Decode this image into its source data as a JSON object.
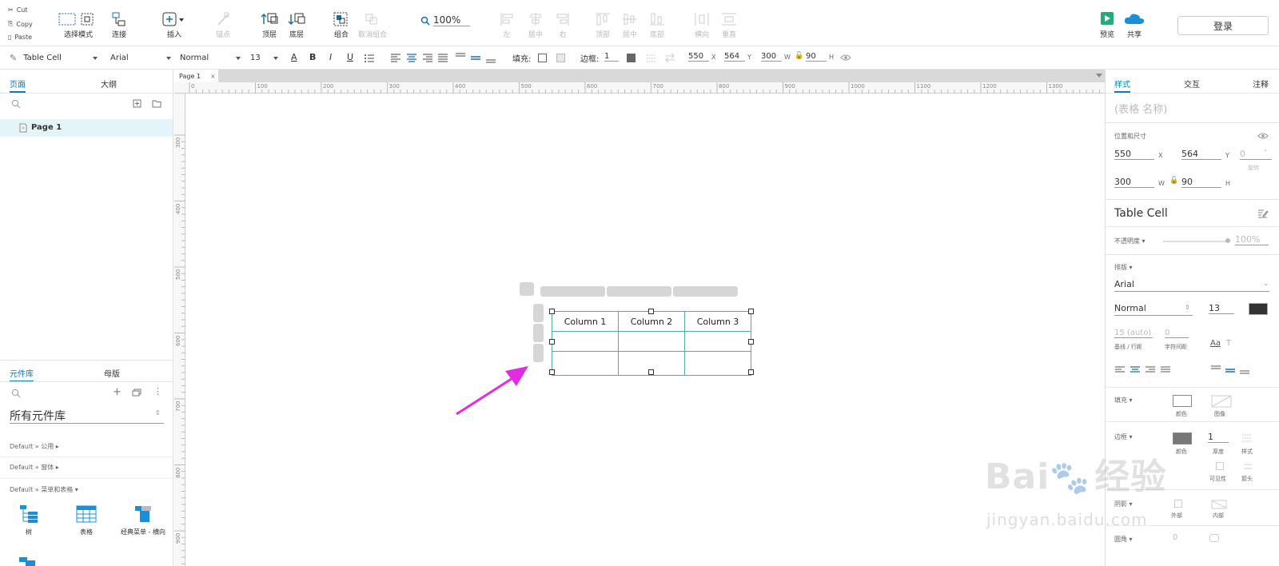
{
  "clipboard": {
    "cut": "Cut",
    "copy": "Copy",
    "paste": "Paste"
  },
  "toolbar": {
    "select_mode": "选择模式",
    "connect": "连接",
    "insert": "插入",
    "anchor": "锚点",
    "top_layer": "顶层",
    "bottom_layer": "底层",
    "group": "组合",
    "ungroup": "取消组合",
    "zoom": "100%",
    "align_left": "左",
    "align_center": "居中",
    "align_right": "右",
    "align_top": "顶部",
    "align_middle": "居中",
    "align_bottom": "底部",
    "dist_h": "横向",
    "dist_v": "垂直",
    "preview": "预览",
    "share": "共享",
    "login": "登录"
  },
  "format": {
    "widget_type": "Table Cell",
    "font": "Arial",
    "weight": "Normal",
    "size": "13",
    "fill_label": "填充:",
    "border_label": "边框:",
    "border_value": "1",
    "x": "550",
    "x_label": "X",
    "y": "564",
    "y_label": "Y",
    "w": "300",
    "w_label": "W",
    "h": "90",
    "h_label": "H"
  },
  "left": {
    "tab_pages": "页面",
    "tab_outline": "大纲",
    "pages": [
      "Page 1"
    ],
    "tab_library": "元件库",
    "tab_masters": "母版",
    "library_select": "所有元件库",
    "groups": [
      "Default » 公用 ▸",
      "Default » 窗体 ▸",
      "Default » 菜单和表格 ▾"
    ],
    "widgets": [
      "树",
      "表格",
      "经典菜单 - 横向"
    ]
  },
  "canvas": {
    "page_tab": "Page 1",
    "hruler": [
      "0",
      "100",
      "200",
      "300",
      "400",
      "500",
      "600",
      "700",
      "800",
      "900",
      "1000",
      "1100",
      "1200",
      "1300"
    ],
    "vruler": [
      "300",
      "400",
      "500",
      "600",
      "700",
      "800",
      "900"
    ],
    "table_headers": [
      "Column 1",
      "Column 2",
      "Column 3"
    ]
  },
  "right": {
    "tab_style": "样式",
    "tab_interact": "交互",
    "tab_notes": "注释",
    "name_placeholder": "(表格 名称)",
    "pos_size": "位置和尺寸",
    "x": "550",
    "x_label": "X",
    "y": "564",
    "y_label": "Y",
    "rot": "0",
    "rot_unit": "°",
    "rot_label": "旋转",
    "w": "300",
    "w_label": "W",
    "h": "90",
    "h_label": "H",
    "widget_type": "Table Cell",
    "opacity_label": "不透明度 ▾",
    "opacity": "100%",
    "typography_label": "排版 ▾",
    "font": "Arial",
    "weight": "Normal",
    "size": "13",
    "line_height": "15 (auto)",
    "char_spacing": "0",
    "line_height_label": "基线 / 行距",
    "char_spacing_label": "字符间距",
    "fill_label": "填充 ▾",
    "fill_color": "颜色",
    "fill_image": "图像",
    "border_label": "边框 ▾",
    "border_color": "颜色",
    "border_thickness_val": "1",
    "border_thickness": "厚度",
    "border_style": "样式",
    "visibility": "可见性",
    "arrow": "箭头",
    "shadow_label": "阴影 ▾",
    "shadow_outer": "外部",
    "shadow_inner": "内部",
    "corner_label": "圆角 ▾",
    "corner_value": "0"
  },
  "watermark": {
    "brand": "Bai",
    "brand2": "经验",
    "site": "jingyan.baidu.com"
  },
  "colors": {
    "accent": "#0b7eb5",
    "arrow": "#e22be2",
    "selection": "#3aa"
  }
}
